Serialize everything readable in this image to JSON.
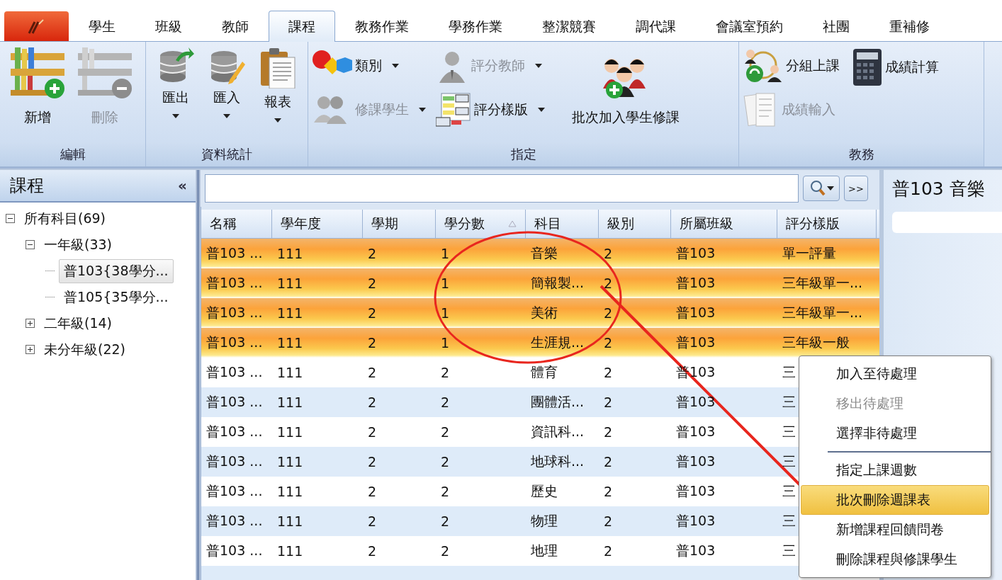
{
  "app_tabs": [
    {
      "label": "學生",
      "selected": false
    },
    {
      "label": "班級",
      "selected": false
    },
    {
      "label": "教師",
      "selected": false
    },
    {
      "label": "課程",
      "selected": true
    },
    {
      "label": "教務作業",
      "selected": false
    },
    {
      "label": "學務作業",
      "selected": false
    },
    {
      "label": "整潔競賽",
      "selected": false
    },
    {
      "label": "調代課",
      "selected": false
    },
    {
      "label": "會議室預約",
      "selected": false
    },
    {
      "label": "社團",
      "selected": false
    },
    {
      "label": "重補修",
      "selected": false
    }
  ],
  "ribbon": {
    "groups": [
      {
        "label": "編輯",
        "buttons": [
          {
            "label": "新增",
            "disabled": false
          },
          {
            "label": "刪除",
            "disabled": true
          }
        ]
      },
      {
        "label": "資料統計",
        "buttons": [
          {
            "label": "匯出",
            "dropdown": true
          },
          {
            "label": "匯入",
            "dropdown": true
          },
          {
            "label": "報表",
            "dropdown": true
          }
        ]
      },
      {
        "label": "指定",
        "buttons": [
          {
            "label": "類別",
            "dropdown": true,
            "disabled": false
          },
          {
            "label": "修課學生",
            "dropdown": true,
            "disabled": true
          },
          {
            "label": "評分教師",
            "dropdown": true,
            "disabled": true
          },
          {
            "label": "評分樣版",
            "dropdown": true,
            "disabled": false
          },
          {
            "label": "批次加入學生修課",
            "disabled": false
          }
        ]
      },
      {
        "label": "教務",
        "buttons": [
          {
            "label": "分組上課",
            "disabled": false
          },
          {
            "label": "成績輸入",
            "disabled": true
          },
          {
            "label": "成績計算",
            "disabled": false
          }
        ]
      }
    ]
  },
  "sidebar": {
    "title": "課程",
    "collapse": "«",
    "tree": [
      {
        "label": "所有科目(69)",
        "expanded": true,
        "selected": false,
        "children": [
          {
            "label": "一年級(33)",
            "expanded": true,
            "selected": false,
            "children": [
              {
                "label": "普103{38學分...",
                "selected": true
              },
              {
                "label": "普105{35學分...",
                "selected": false
              }
            ]
          },
          {
            "label": "二年級(14)",
            "expanded": false,
            "selected": false
          },
          {
            "label": "未分年級(22)",
            "expanded": false,
            "selected": false
          }
        ]
      }
    ]
  },
  "search": {
    "more_label": ">>"
  },
  "table": {
    "columns": [
      {
        "label": "名稱",
        "sorted": false
      },
      {
        "label": "學年度",
        "sorted": false
      },
      {
        "label": "學期",
        "sorted": false
      },
      {
        "label": "學分數",
        "sorted": true
      },
      {
        "label": "科目",
        "sorted": false
      },
      {
        "label": "級別",
        "sorted": false
      },
      {
        "label": "所屬班級",
        "sorted": false
      },
      {
        "label": "評分樣版",
        "sorted": false
      }
    ],
    "rows": [
      {
        "selected": true,
        "cells": [
          "普103 ...",
          "111",
          "2",
          "1",
          "音樂",
          "2",
          "普103",
          "單一評量"
        ]
      },
      {
        "selected": true,
        "cells": [
          "普103 ...",
          "111",
          "2",
          "1",
          "簡報製...",
          "2",
          "普103",
          "三年級單一..."
        ]
      },
      {
        "selected": true,
        "cells": [
          "普103 ...",
          "111",
          "2",
          "1",
          "美術",
          "2",
          "普103",
          "三年級單一..."
        ]
      },
      {
        "selected": true,
        "cells": [
          "普103 ...",
          "111",
          "2",
          "1",
          "生涯規...",
          "2",
          "普103",
          "三年級一般"
        ]
      },
      {
        "selected": false,
        "cells": [
          "普103 ...",
          "111",
          "2",
          "2",
          "體育",
          "2",
          "普103",
          "三"
        ]
      },
      {
        "selected": false,
        "cells": [
          "普103 ...",
          "111",
          "2",
          "2",
          "團體活...",
          "2",
          "普103",
          "三"
        ]
      },
      {
        "selected": false,
        "cells": [
          "普103 ...",
          "111",
          "2",
          "2",
          "資訊科...",
          "2",
          "普103",
          "三"
        ]
      },
      {
        "selected": false,
        "cells": [
          "普103 ...",
          "111",
          "2",
          "2",
          "地球科...",
          "2",
          "普103",
          "三"
        ]
      },
      {
        "selected": false,
        "cells": [
          "普103 ...",
          "111",
          "2",
          "2",
          "歷史",
          "2",
          "普103",
          "三"
        ]
      },
      {
        "selected": false,
        "cells": [
          "普103 ...",
          "111",
          "2",
          "2",
          "物理",
          "2",
          "普103",
          "三"
        ]
      },
      {
        "selected": false,
        "cells": [
          "普103 ...",
          "111",
          "2",
          "2",
          "地理",
          "2",
          "普103",
          "三"
        ]
      }
    ]
  },
  "detail": {
    "title": "普103 音樂"
  },
  "context_menu": {
    "sections": [
      {
        "items": [
          {
            "label": "加入至待處理",
            "disabled": false,
            "selected": false
          },
          {
            "label": "移出待處理",
            "disabled": true,
            "selected": false
          },
          {
            "label": "選擇非待處理",
            "disabled": false,
            "selected": false
          }
        ]
      },
      {
        "items": [
          {
            "label": "指定上課週數",
            "disabled": false,
            "selected": false
          },
          {
            "label": "批次刪除週課表",
            "disabled": false,
            "selected": true
          },
          {
            "label": "新增課程回饋問卷",
            "disabled": false,
            "selected": false
          },
          {
            "label": "刪除課程與修課學生",
            "disabled": false,
            "selected": false
          }
        ]
      }
    ]
  }
}
